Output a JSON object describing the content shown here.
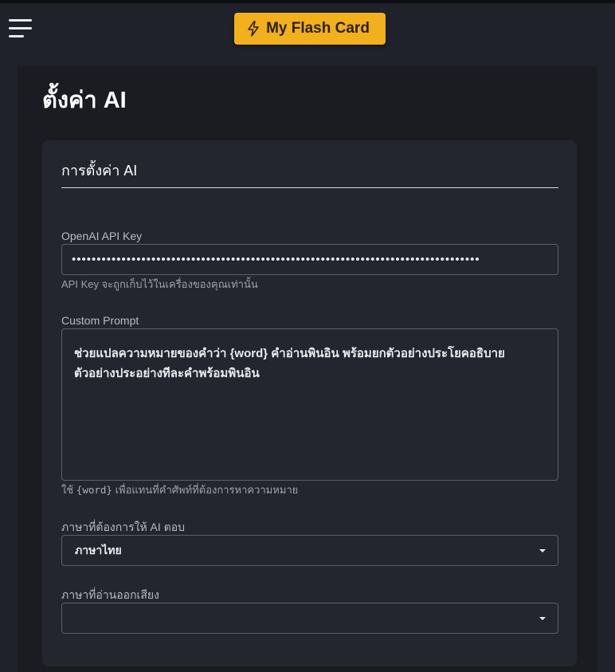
{
  "header": {
    "brand_label": "My Flash Card",
    "brand_color": "#f1b01c",
    "menu_icon": "hamburger-menu-icon",
    "brand_icon": "lightning-bolt-icon"
  },
  "page": {
    "title": "ตั้งค่า AI"
  },
  "card": {
    "title": "การตั้งค่า AI",
    "api_key": {
      "label": "OpenAI API Key",
      "value": "••••••••••••••••••••••••••••••••••••••••••••••••••••••••••••••••••••••••••••••••••",
      "helper": "API Key จะถูกเก็บไว้ในเครื่องของคุณเท่านั้น"
    },
    "prompt": {
      "label": "Custom Prompt",
      "value": "ช่วยแปลความหมายของคำว่า {word} คำอ่านพินอิน พร้อมยกตัวอย่างประโยคอธิบาย ตัวอย่างประอย่างทีละคำพร้อมพินอิน",
      "helper_prefix": "ใช้",
      "helper_code": "{word}",
      "helper_suffix": "เพื่อแทนที่คำศัพท์ที่ต้องการหาความหมาย"
    },
    "response_language": {
      "label": "ภาษาที่ต้องการให้ AI ตอบ",
      "selected": "ภาษาไทย"
    },
    "pronunciation_language": {
      "label": "ภาษาที่อ่านออกเสียง",
      "selected": ""
    }
  }
}
